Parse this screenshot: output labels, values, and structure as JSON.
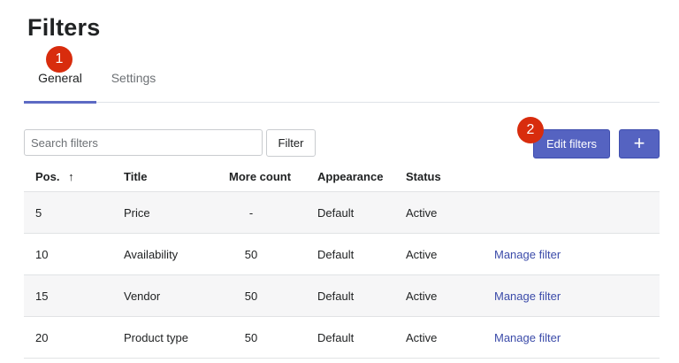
{
  "page": {
    "title": "Filters"
  },
  "tabs": [
    {
      "label": "General",
      "active": true
    },
    {
      "label": "Settings",
      "active": false
    }
  ],
  "badges": {
    "one": "1",
    "two": "2",
    "color": "#d82c0d"
  },
  "toolbar": {
    "search_placeholder": "Search filters",
    "search_value": "",
    "filter_label": "Filter",
    "edit_filters_label": "Edit filters",
    "add_label": "+"
  },
  "table": {
    "headers": {
      "pos": "Pos.",
      "sort_icon": "↑",
      "title": "Title",
      "more_count": "More count",
      "appearance": "Appearance",
      "status": "Status"
    },
    "rows": [
      {
        "pos": "5",
        "title": "Price",
        "more_count": "-",
        "appearance": "Default",
        "status": "Active",
        "action": ""
      },
      {
        "pos": "10",
        "title": "Availability",
        "more_count": "50",
        "appearance": "Default",
        "status": "Active",
        "action": "Manage filter"
      },
      {
        "pos": "15",
        "title": "Vendor",
        "more_count": "50",
        "appearance": "Default",
        "status": "Active",
        "action": "Manage filter"
      },
      {
        "pos": "20",
        "title": "Product type",
        "more_count": "50",
        "appearance": "Default",
        "status": "Active",
        "action": "Manage filter"
      }
    ]
  },
  "colors": {
    "accent": "#5563c1",
    "link": "#3b4ba9",
    "tab_underline": "#5c6ac4"
  }
}
